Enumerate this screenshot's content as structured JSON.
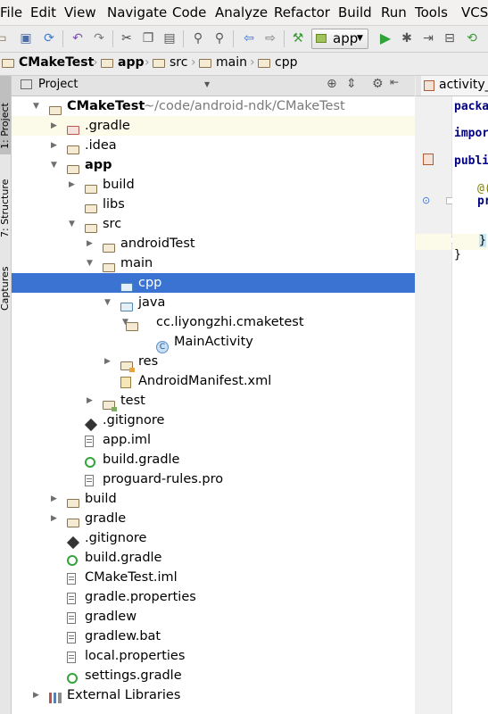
{
  "menu": [
    "File",
    "Edit",
    "View",
    "Navigate",
    "Code",
    "Analyze",
    "Refactor",
    "Build",
    "Run",
    "Tools",
    "VCS"
  ],
  "toolbar": {
    "run_config": "app",
    "icons": [
      "save-all-icon",
      "sync-icon",
      "undo-icon",
      "redo-icon",
      "cut-icon",
      "copy-icon",
      "paste-icon",
      "find-icon",
      "replace-icon",
      "back-icon",
      "forward-icon",
      "make-project-icon",
      "run-icon",
      "debug-icon",
      "attach-debugger-icon",
      "apply-changes-icon",
      "gradle-sync-icon"
    ]
  },
  "breadcrumb": [
    "CMakeTest",
    "app",
    "src",
    "main",
    "cpp"
  ],
  "side_tabs": [
    "1: Project",
    "7: Structure",
    "Captures"
  ],
  "project_panel": {
    "view_mode": "Project"
  },
  "tree": [
    {
      "label": "CMakeTest",
      "path": "~/code/android-ndk/CMakeTest",
      "icon": "module",
      "depth": 0,
      "expanded": true,
      "bold": true
    },
    {
      "label": ".gradle",
      "icon": "folder-excluded",
      "depth": 1,
      "expanded": false,
      "highlight": true
    },
    {
      "label": ".idea",
      "icon": "folder",
      "depth": 1,
      "expanded": false
    },
    {
      "label": "app",
      "icon": "module",
      "depth": 1,
      "expanded": true,
      "bold": true
    },
    {
      "label": "build",
      "icon": "folder",
      "depth": 2,
      "expanded": false
    },
    {
      "label": "libs",
      "icon": "folder",
      "depth": 2,
      "leaf": true
    },
    {
      "label": "src",
      "icon": "folder",
      "depth": 2,
      "expanded": true
    },
    {
      "label": "androidTest",
      "icon": "folder",
      "depth": 3,
      "expanded": false
    },
    {
      "label": "main",
      "icon": "folder",
      "depth": 3,
      "expanded": true
    },
    {
      "label": "cpp",
      "icon": "folder-source",
      "depth": 4,
      "leaf": true,
      "selected": true
    },
    {
      "label": "java",
      "icon": "folder-source",
      "depth": 4,
      "expanded": true
    },
    {
      "label": "cc.liyongzhi.cmaketest",
      "icon": "package",
      "depth": 5,
      "expanded": true
    },
    {
      "label": "MainActivity",
      "icon": "class",
      "depth": 6,
      "leaf": true
    },
    {
      "label": "res",
      "icon": "folder-res",
      "depth": 4,
      "expanded": false
    },
    {
      "label": "AndroidManifest.xml",
      "icon": "xml",
      "depth": 4,
      "leaf": true
    },
    {
      "label": "test",
      "icon": "folder-test",
      "depth": 3,
      "expanded": false
    },
    {
      "label": ".gitignore",
      "icon": "git",
      "depth": 2,
      "leaf": true
    },
    {
      "label": "app.iml",
      "icon": "iml",
      "depth": 2,
      "leaf": true
    },
    {
      "label": "build.gradle",
      "icon": "gradle",
      "depth": 2,
      "leaf": true
    },
    {
      "label": "proguard-rules.pro",
      "icon": "text",
      "depth": 2,
      "leaf": true
    },
    {
      "label": "build",
      "icon": "folder",
      "depth": 1,
      "expanded": false
    },
    {
      "label": "gradle",
      "icon": "folder",
      "depth": 1,
      "expanded": false
    },
    {
      "label": ".gitignore",
      "icon": "git",
      "depth": 1,
      "leaf": true
    },
    {
      "label": "build.gradle",
      "icon": "gradle",
      "depth": 1,
      "leaf": true
    },
    {
      "label": "CMakeTest.iml",
      "icon": "iml",
      "depth": 1,
      "leaf": true
    },
    {
      "label": "gradle.properties",
      "icon": "text",
      "depth": 1,
      "leaf": true
    },
    {
      "label": "gradlew",
      "icon": "text",
      "depth": 1,
      "leaf": true
    },
    {
      "label": "gradlew.bat",
      "icon": "text",
      "depth": 1,
      "leaf": true
    },
    {
      "label": "local.properties",
      "icon": "text",
      "depth": 1,
      "leaf": true
    },
    {
      "label": "settings.gradle",
      "icon": "gradle",
      "depth": 1,
      "leaf": true
    },
    {
      "label": "External Libraries",
      "icon": "library",
      "depth": 0,
      "expanded": false
    }
  ],
  "editor": {
    "tab_label": "activity_",
    "lines": [
      "packag",
      "",
      "import",
      "",
      "public",
      "",
      "",
      "@(",
      "pr",
      "",
      "",
      "}",
      "}"
    ]
  }
}
